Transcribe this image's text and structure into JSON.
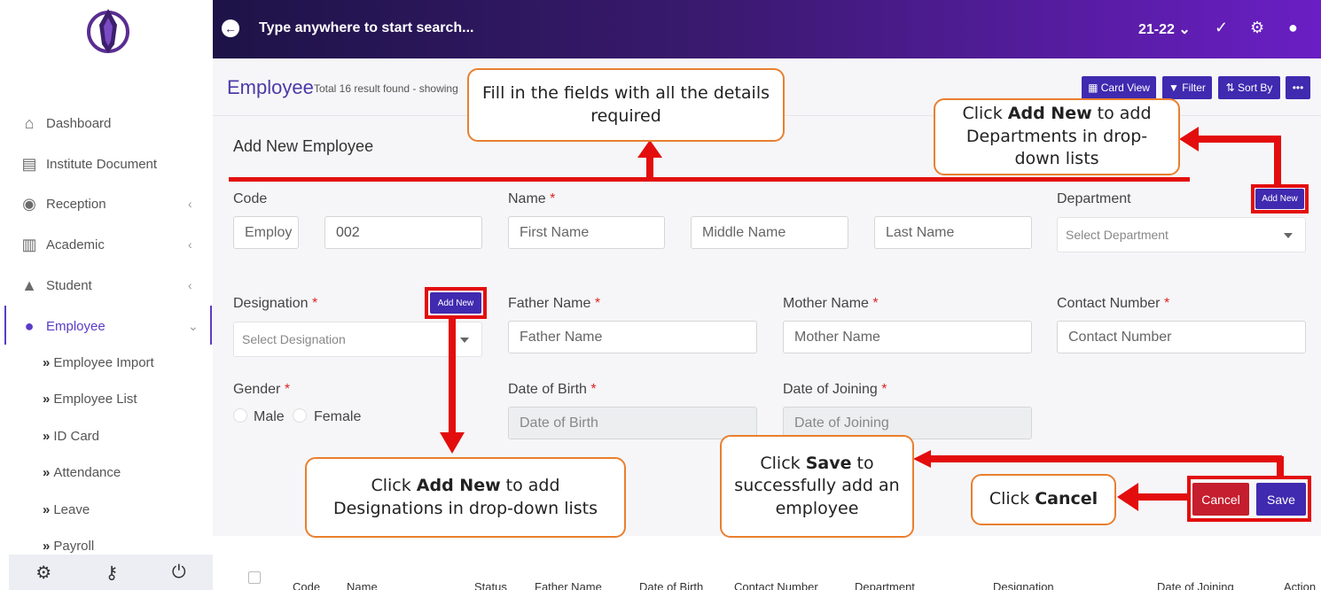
{
  "sidebar": {
    "items": [
      {
        "label": "Dashboard",
        "icon": "home-icon"
      },
      {
        "label": "Institute Document",
        "icon": "document-icon"
      },
      {
        "label": "Reception",
        "icon": "user-circle-icon"
      },
      {
        "label": "Academic",
        "icon": "school-icon"
      },
      {
        "label": "Student",
        "icon": "graduation-cap-icon"
      },
      {
        "label": "Employee",
        "icon": "employee-icon"
      }
    ],
    "sub_items": [
      "Employee Import",
      "Employee List",
      "ID Card",
      "Attendance",
      "Leave",
      "Payroll"
    ],
    "footer_icons": [
      "settings-icon",
      "key-icon",
      "power-icon"
    ]
  },
  "topbar": {
    "search_placeholder": "Type anywhere to start search...",
    "year": "21-22"
  },
  "header": {
    "title": "Employee",
    "subtitle": "Total 16 result found - showing",
    "buttons": {
      "card_view": "Card View",
      "filter": "Filter",
      "sort_by": "Sort By",
      "more": "•••"
    }
  },
  "form": {
    "title": "Add New Employee",
    "code_label": "Code",
    "code_prefix": "Employ",
    "code_value": "002",
    "name_label": "Name",
    "first_name": "First Name",
    "middle_name": "Middle Name",
    "last_name": "Last Name",
    "department_label": "Department",
    "department_placeholder": "Select Department",
    "designation_label": "Designation",
    "designation_placeholder": "Select Designation",
    "add_new": "Add New",
    "father_label": "Father Name",
    "father_placeholder": "Father Name",
    "mother_label": "Mother Name",
    "mother_placeholder": "Mother Name",
    "contact_label": "Contact Number",
    "contact_placeholder": "Contact Number",
    "gender_label": "Gender",
    "male": "Male",
    "female": "Female",
    "dob_label": "Date of Birth",
    "dob_placeholder": "Date of Birth",
    "doj_label": "Date of Joining",
    "doj_placeholder": "Date of Joining",
    "required_mark": "*",
    "cancel": "Cancel",
    "save": "Save"
  },
  "table": {
    "headers": [
      "Code",
      "Name",
      "Status",
      "Father Name",
      "Date of Birth",
      "Contact Number",
      "Department",
      "Designation",
      "Date of Joining",
      "Action"
    ]
  },
  "callouts": {
    "fill_fields": "Fill in the fields with all the details required",
    "add_dept_pre": "Click ",
    "add_dept_bold": "Add New",
    "add_dept_post": " to add Departments in drop-down lists",
    "add_desig_pre": "Click ",
    "add_desig_bold": "Add New",
    "add_desig_post": " to add Designations in drop-down lists",
    "save_pre": "Click ",
    "save_bold": "Save",
    "save_post": " to successfully add an employee",
    "cancel_pre": "Click ",
    "cancel_bold": "Cancel"
  },
  "colors": {
    "accent": "#3f2ab0",
    "annotation_red": "#e30d0d",
    "callout_border": "#e97f2f",
    "cancel": "#c51e2e"
  }
}
